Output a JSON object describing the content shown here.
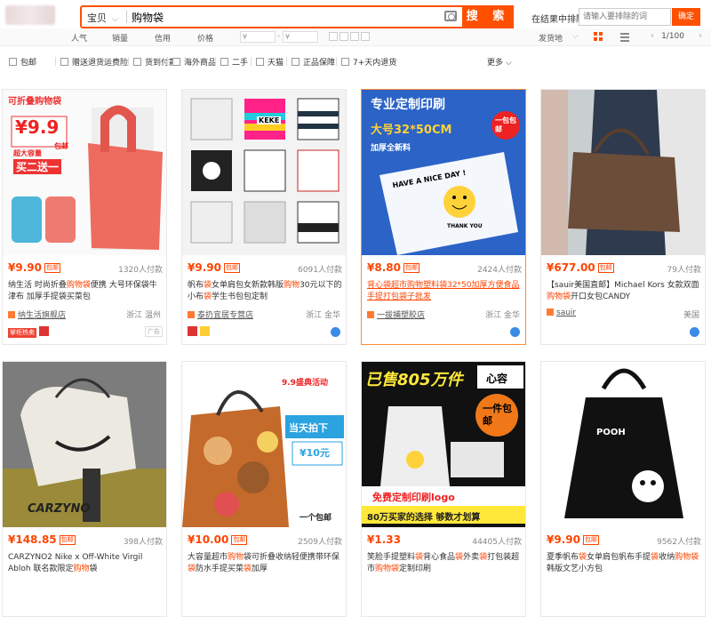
{
  "search": {
    "category": "宝贝",
    "query": "购物袋",
    "button_label": "搜 索",
    "in_result_label": "在结果中排除",
    "in_result_placeholder": "请输入要排除的词",
    "confirm_label": "确定"
  },
  "sortbar": {
    "items": [
      "人气",
      "销量",
      "信用",
      "价格"
    ],
    "price_from": "¥",
    "price_to": "¥",
    "ship_from": "发货地",
    "page": "1/100"
  },
  "filters": {
    "items": [
      "包邮",
      "赠送退货运费险",
      "货到付款",
      "海外商品",
      "二手",
      "天猫",
      "正品保障",
      "7+天内退货"
    ],
    "more_label": "更多"
  },
  "products": [
    {
      "price": "¥9.90",
      "tag": "包邮",
      "paid": "1320人付款",
      "title": [
        "纳生活 时尚折叠",
        "购物袋",
        "便携 大号环保袋牛津布 加厚手提袋买菜包"
      ],
      "shop": "纳生活旗舰店",
      "location": "浙江 温州",
      "badge": "掌柜热卖",
      "ad": "广告",
      "img_text": {
        "top": "可折叠购物袋",
        "price": "¥9.9",
        "note1": "包邮",
        "note2": "超大容量",
        "promo": "买二送一"
      }
    },
    {
      "price": "¥9.90",
      "tag": "包邮",
      "paid": "6091人付款",
      "title": [
        "帆布",
        "袋",
        "女单肩包女新款韩版",
        "购物",
        "30元以下的小布",
        "袋",
        "学生书包包定制"
      ],
      "shop": "泰扔宜居专营店",
      "location": "浙江 金华",
      "img_text": {
        "brand": "KEKE"
      }
    },
    {
      "price": "¥8.80",
      "tag": "包邮",
      "paid": "2424人付款",
      "title": [
        "背心",
        "袋",
        "超市",
        "购物",
        "塑料",
        "袋",
        "32*50加厚方便食品手提打包",
        "袋",
        "子批发"
      ],
      "shop": "一拔捕塑胶店",
      "location": "浙江 金华",
      "img_text": {
        "head": "专业定制印刷",
        "size": "大号32*50CM",
        "thick": "加厚全新料",
        "seal": "一包包邮",
        "bag": "HAVE A NICE DAY !",
        "thanks": "THANK YOU"
      }
    },
    {
      "price": "¥677.00",
      "tag": "包邮",
      "paid": "79人付款",
      "title": [
        "【sauir美国直邮】Michael Kors 女款双面",
        "购物袋",
        "开口女包CANDY"
      ],
      "shop": "sauir",
      "location": "美国"
    },
    {
      "price": "¥148.85",
      "tag": "包邮",
      "paid": "398人付款",
      "title": [
        "CARZYNO2 Nike x Off-White Virgil Abloh 联名款限定",
        "购物",
        "袋"
      ],
      "shop": "",
      "location": "",
      "img_text": {
        "mark": "CARZYNO"
      }
    },
    {
      "price": "¥10.00",
      "tag": "包邮",
      "paid": "2509人付款",
      "title": [
        "大容量超市",
        "购物",
        "袋可折叠收纳轻便携带环保",
        "袋",
        "防水手提买菜",
        "袋",
        "加厚"
      ],
      "shop": "",
      "location": "",
      "img_text": {
        "promo": "9.9盛典活动",
        "today": "当天拍下",
        "price": "¥10元",
        "ship": "一个包邮"
      }
    },
    {
      "price": "¥1.33",
      "tag": "",
      "paid": "44405人付款",
      "title": [
        "笑脸手提塑料",
        "袋",
        "背心食品",
        "袋",
        "外卖",
        "袋",
        "打包装超市",
        "购物袋",
        "定制印刷"
      ],
      "shop": "",
      "location": "",
      "img_text": {
        "sold": "已售805万件",
        "brand": "心容",
        "one": "一件包邮",
        "free": "免费定制印刷logo",
        "choice": "80万买家的选择 够数才划算"
      }
    },
    {
      "price": "¥9.90",
      "tag": "包邮",
      "paid": "9562人付款",
      "title": [
        "夏季帆布",
        "袋",
        "女单肩包帆布手提",
        "袋",
        "收纳",
        "购物袋",
        "韩版文艺小方包"
      ],
      "shop": "",
      "location": "",
      "img_text": {
        "brand": "POOH"
      }
    }
  ]
}
